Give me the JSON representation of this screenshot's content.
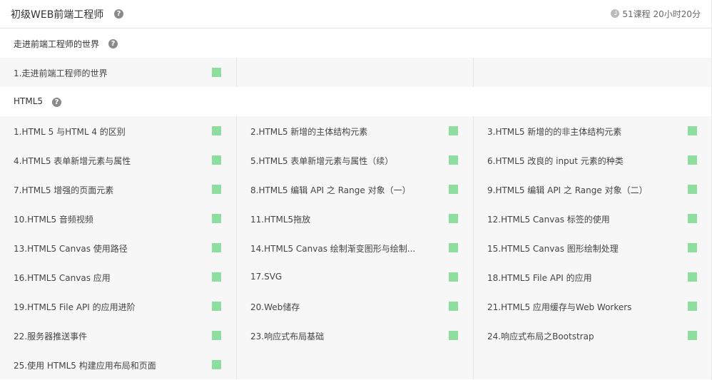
{
  "course": {
    "title": "初级WEB前端工程师",
    "meta": "51课程 20小时20分",
    "help_icon": "question-icon",
    "clock_icon": "clock-icon"
  },
  "colors": {
    "status_complete": "#8ede9f"
  },
  "chapters": [
    {
      "title": "走进前端工程师的世界",
      "lessons": [
        {
          "label": "1.走进前端工程师的世界"
        }
      ]
    },
    {
      "title": "HTML5",
      "lessons": [
        {
          "label": "1.HTML 5 与HTML 4 的区别"
        },
        {
          "label": "2.HTML5 新增的主体结构元素"
        },
        {
          "label": "3.HTML5 新增的的非主体结构元素"
        },
        {
          "label": "4.HTML5 表单新增元素与属性"
        },
        {
          "label": "5.HTML5 表单新增元素与属性（续）"
        },
        {
          "label": "6.HTML5 改良的 input 元素的种类"
        },
        {
          "label": "7.HTML5 增强的页面元素"
        },
        {
          "label": "8.HTML5 编辑 API 之 Range 对象（一）"
        },
        {
          "label": "9.HTML5 编辑 API 之 Range 对象（二）"
        },
        {
          "label": "10.HTML5 音频视频"
        },
        {
          "label": "11.HTML5拖放"
        },
        {
          "label": "12.HTML5 Canvas 标签的使用"
        },
        {
          "label": "13.HTML5 Canvas 使用路径"
        },
        {
          "label": "14.HTML5 Canvas 绘制渐变图形与绘制..."
        },
        {
          "label": "15.HTML5 Canvas 图形绘制处理"
        },
        {
          "label": "16.HTML5 Canvas 应用"
        },
        {
          "label": "17.SVG"
        },
        {
          "label": "18.HTML5 File API 的应用"
        },
        {
          "label": "19.HTML5 File API 的应用进阶"
        },
        {
          "label": "20.Web储存"
        },
        {
          "label": "21.HTML5 应用缓存与Web Workers"
        },
        {
          "label": "22.服务器推送事件"
        },
        {
          "label": "23.响应式布局基础"
        },
        {
          "label": "24.响应式布局之Bootstrap"
        },
        {
          "label": "25.使用 HTML5 构建应用布局和页面"
        }
      ]
    }
  ]
}
